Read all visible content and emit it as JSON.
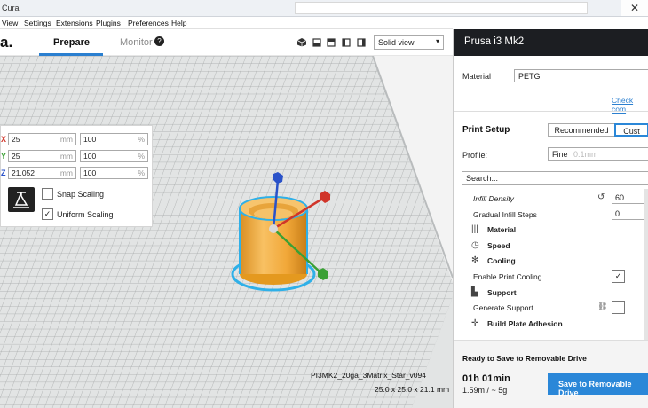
{
  "titlebar": {
    "title": "Cura",
    "close_glyph": "✕"
  },
  "menu": [
    "View",
    "Settings",
    "Extensions",
    "Plugins",
    "Preferences",
    "Help"
  ],
  "header": {
    "logo_text": "a.",
    "tabs": {
      "prepare": "Prepare",
      "monitor": "Monitor",
      "help_glyph": "?"
    },
    "view_select": {
      "value": "Solid view",
      "arrow": "▾"
    },
    "view_icons": [
      "3d-view-icon",
      "front-view-icon",
      "top-view-icon",
      "left-view-icon",
      "right-view-icon"
    ]
  },
  "scale": {
    "rows": [
      {
        "axis": "X",
        "axis_color": "#d0352a",
        "mm": "25",
        "mm_unit": "mm",
        "pct": "100",
        "pct_unit": "%"
      },
      {
        "axis": "Y",
        "axis_color": "#3aa035",
        "mm": "25",
        "mm_unit": "mm",
        "pct": "100",
        "pct_unit": "%"
      },
      {
        "axis": "Z",
        "axis_color": "#2a52c9",
        "mm": "21.052",
        "mm_unit": "mm",
        "pct": "100",
        "pct_unit": "%"
      }
    ],
    "snap_label": "Snap Scaling",
    "snap_checked": false,
    "uniform_label": "Uniform Scaling",
    "uniform_checked": true,
    "check_glyph": "✓"
  },
  "viewport_info": {
    "filename": "PI3MK2_20ga_3Matrix_Star_v094",
    "dimensions": "25.0 x 25.0 x 21.1 mm"
  },
  "right_panel": {
    "printer": "Prusa i3 Mk2",
    "material_label": "Material",
    "material_value": "PETG",
    "check_compat": "Check com",
    "print_setup": "Print Setup",
    "recommended": "Recommended",
    "custom": "Cust",
    "profile_label": "Profile:",
    "profile_value": "Fine",
    "profile_sub": "0.1mm",
    "search_placeholder": "Search...",
    "settings": [
      {
        "kind": "setting",
        "label": "Infill Density",
        "value": "60",
        "reset_glyph": "↺",
        "italic": true
      },
      {
        "kind": "setting",
        "label": "Gradual Infill Steps",
        "value": "0"
      },
      {
        "kind": "category",
        "label": "Material",
        "icon": "|||"
      },
      {
        "kind": "category",
        "label": "Speed",
        "icon": "◷"
      },
      {
        "kind": "category",
        "label": "Cooling",
        "icon": "✻"
      },
      {
        "kind": "setting",
        "label": "Enable Print Cooling",
        "checked": true,
        "check_glyph": "✓"
      },
      {
        "kind": "category",
        "label": "Support",
        "icon": "▙"
      },
      {
        "kind": "setting",
        "label": "Generate Support",
        "checked": false,
        "link_glyph": "⛓"
      },
      {
        "kind": "category",
        "label": "Build Plate Adhesion",
        "icon": "✛"
      }
    ],
    "ready_label": "Ready to Save to Removable Drive",
    "time": "01h 01min",
    "material_use": "1.59m / ~ 5g",
    "save_button": "Save to Removable Drive"
  },
  "colors": {
    "accent": "#2a87d8",
    "model": "#f2a93b",
    "outline": "#2fb0e8",
    "grid_bg": "#eaebeb"
  }
}
